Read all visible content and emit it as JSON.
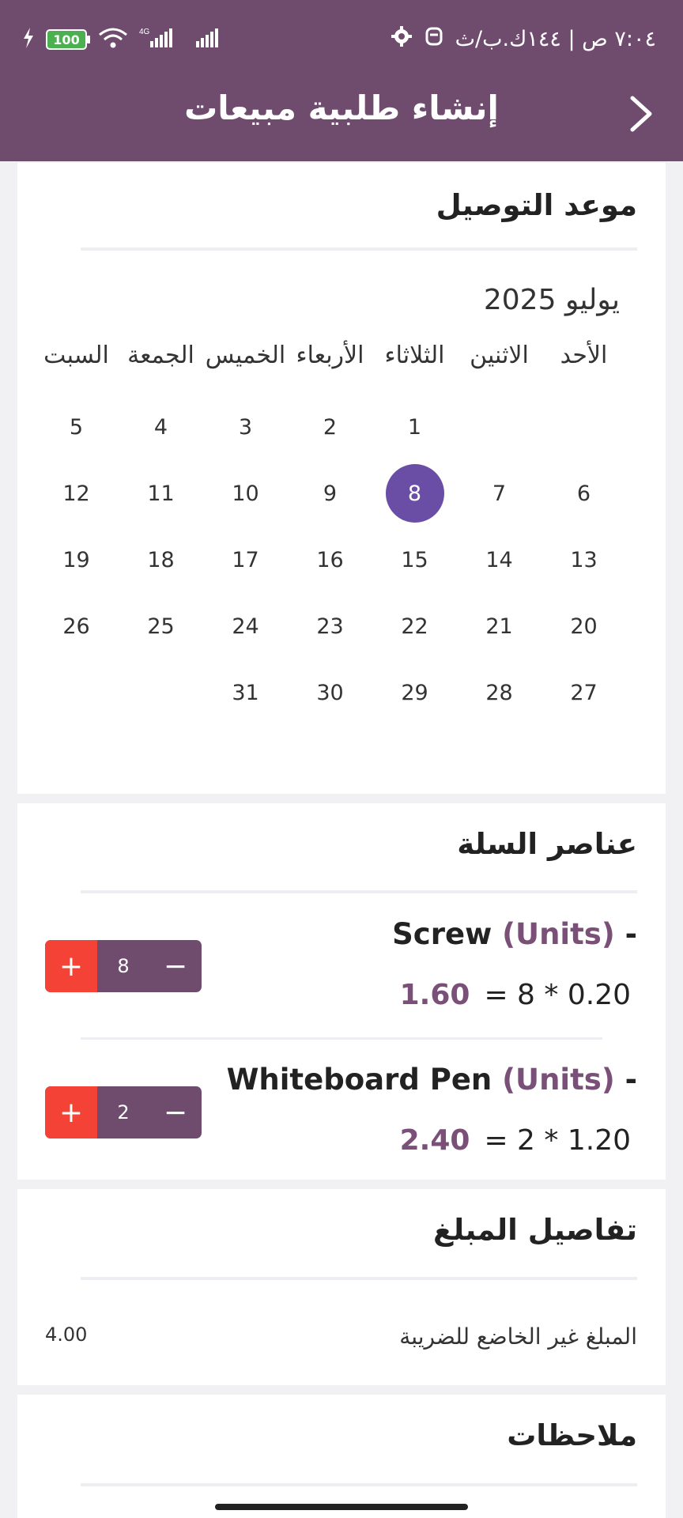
{
  "status_bar": {
    "time": "٧:٠٤ ص | ١٤٤ك.ب/ث",
    "battery": "100",
    "network": "4G",
    "icons": [
      "settings-icon",
      "notification-icon",
      "wifi-icon",
      "signal-icon",
      "charging-icon"
    ]
  },
  "header": {
    "title": "إنشاء طلبية مبيعات",
    "back_icon": "chevron-right-icon"
  },
  "delivery": {
    "title": "موعد التوصيل",
    "month": "يوليو 2025",
    "weekdays": [
      "الأحد",
      "الاثنين",
      "الثلاثاء",
      "الأربعاء",
      "الخميس",
      "الجمعة",
      "السبت"
    ],
    "selected_day": "8",
    "weeks": [
      [
        "",
        "",
        "1",
        "2",
        "3",
        "4",
        "5"
      ],
      [
        "6",
        "7",
        "8",
        "9",
        "10",
        "11",
        "12"
      ],
      [
        "13",
        "14",
        "15",
        "16",
        "17",
        "18",
        "19"
      ],
      [
        "20",
        "21",
        "22",
        "23",
        "24",
        "25",
        "26"
      ],
      [
        "27",
        "28",
        "29",
        "30",
        "31",
        "",
        ""
      ]
    ]
  },
  "cart": {
    "title": "عناصر السلة",
    "items": [
      {
        "name": "Screw",
        "unit": "(Units)",
        "dash": "-",
        "calc": "0.20 * 8 =",
        "total": "1.60",
        "quantity": "8",
        "plus": "+",
        "minus": "−"
      },
      {
        "name": "Whiteboard Pen",
        "unit": "(Units)",
        "dash": "-",
        "calc": "1.20 * 2 =",
        "total": "2.40",
        "quantity": "2",
        "plus": "+",
        "minus": "−"
      }
    ]
  },
  "amount": {
    "title": "تفاصيل المبلغ",
    "untaxed_label": "المبلغ غير الخاضع للضريبة",
    "untaxed_value": "4.00"
  },
  "notes": {
    "title": "ملاحظات"
  },
  "colors": {
    "primary": "#6f4b6e",
    "accent": "#6a4ea6",
    "plus_button": "#f44336",
    "background": "#f1f1f4"
  }
}
